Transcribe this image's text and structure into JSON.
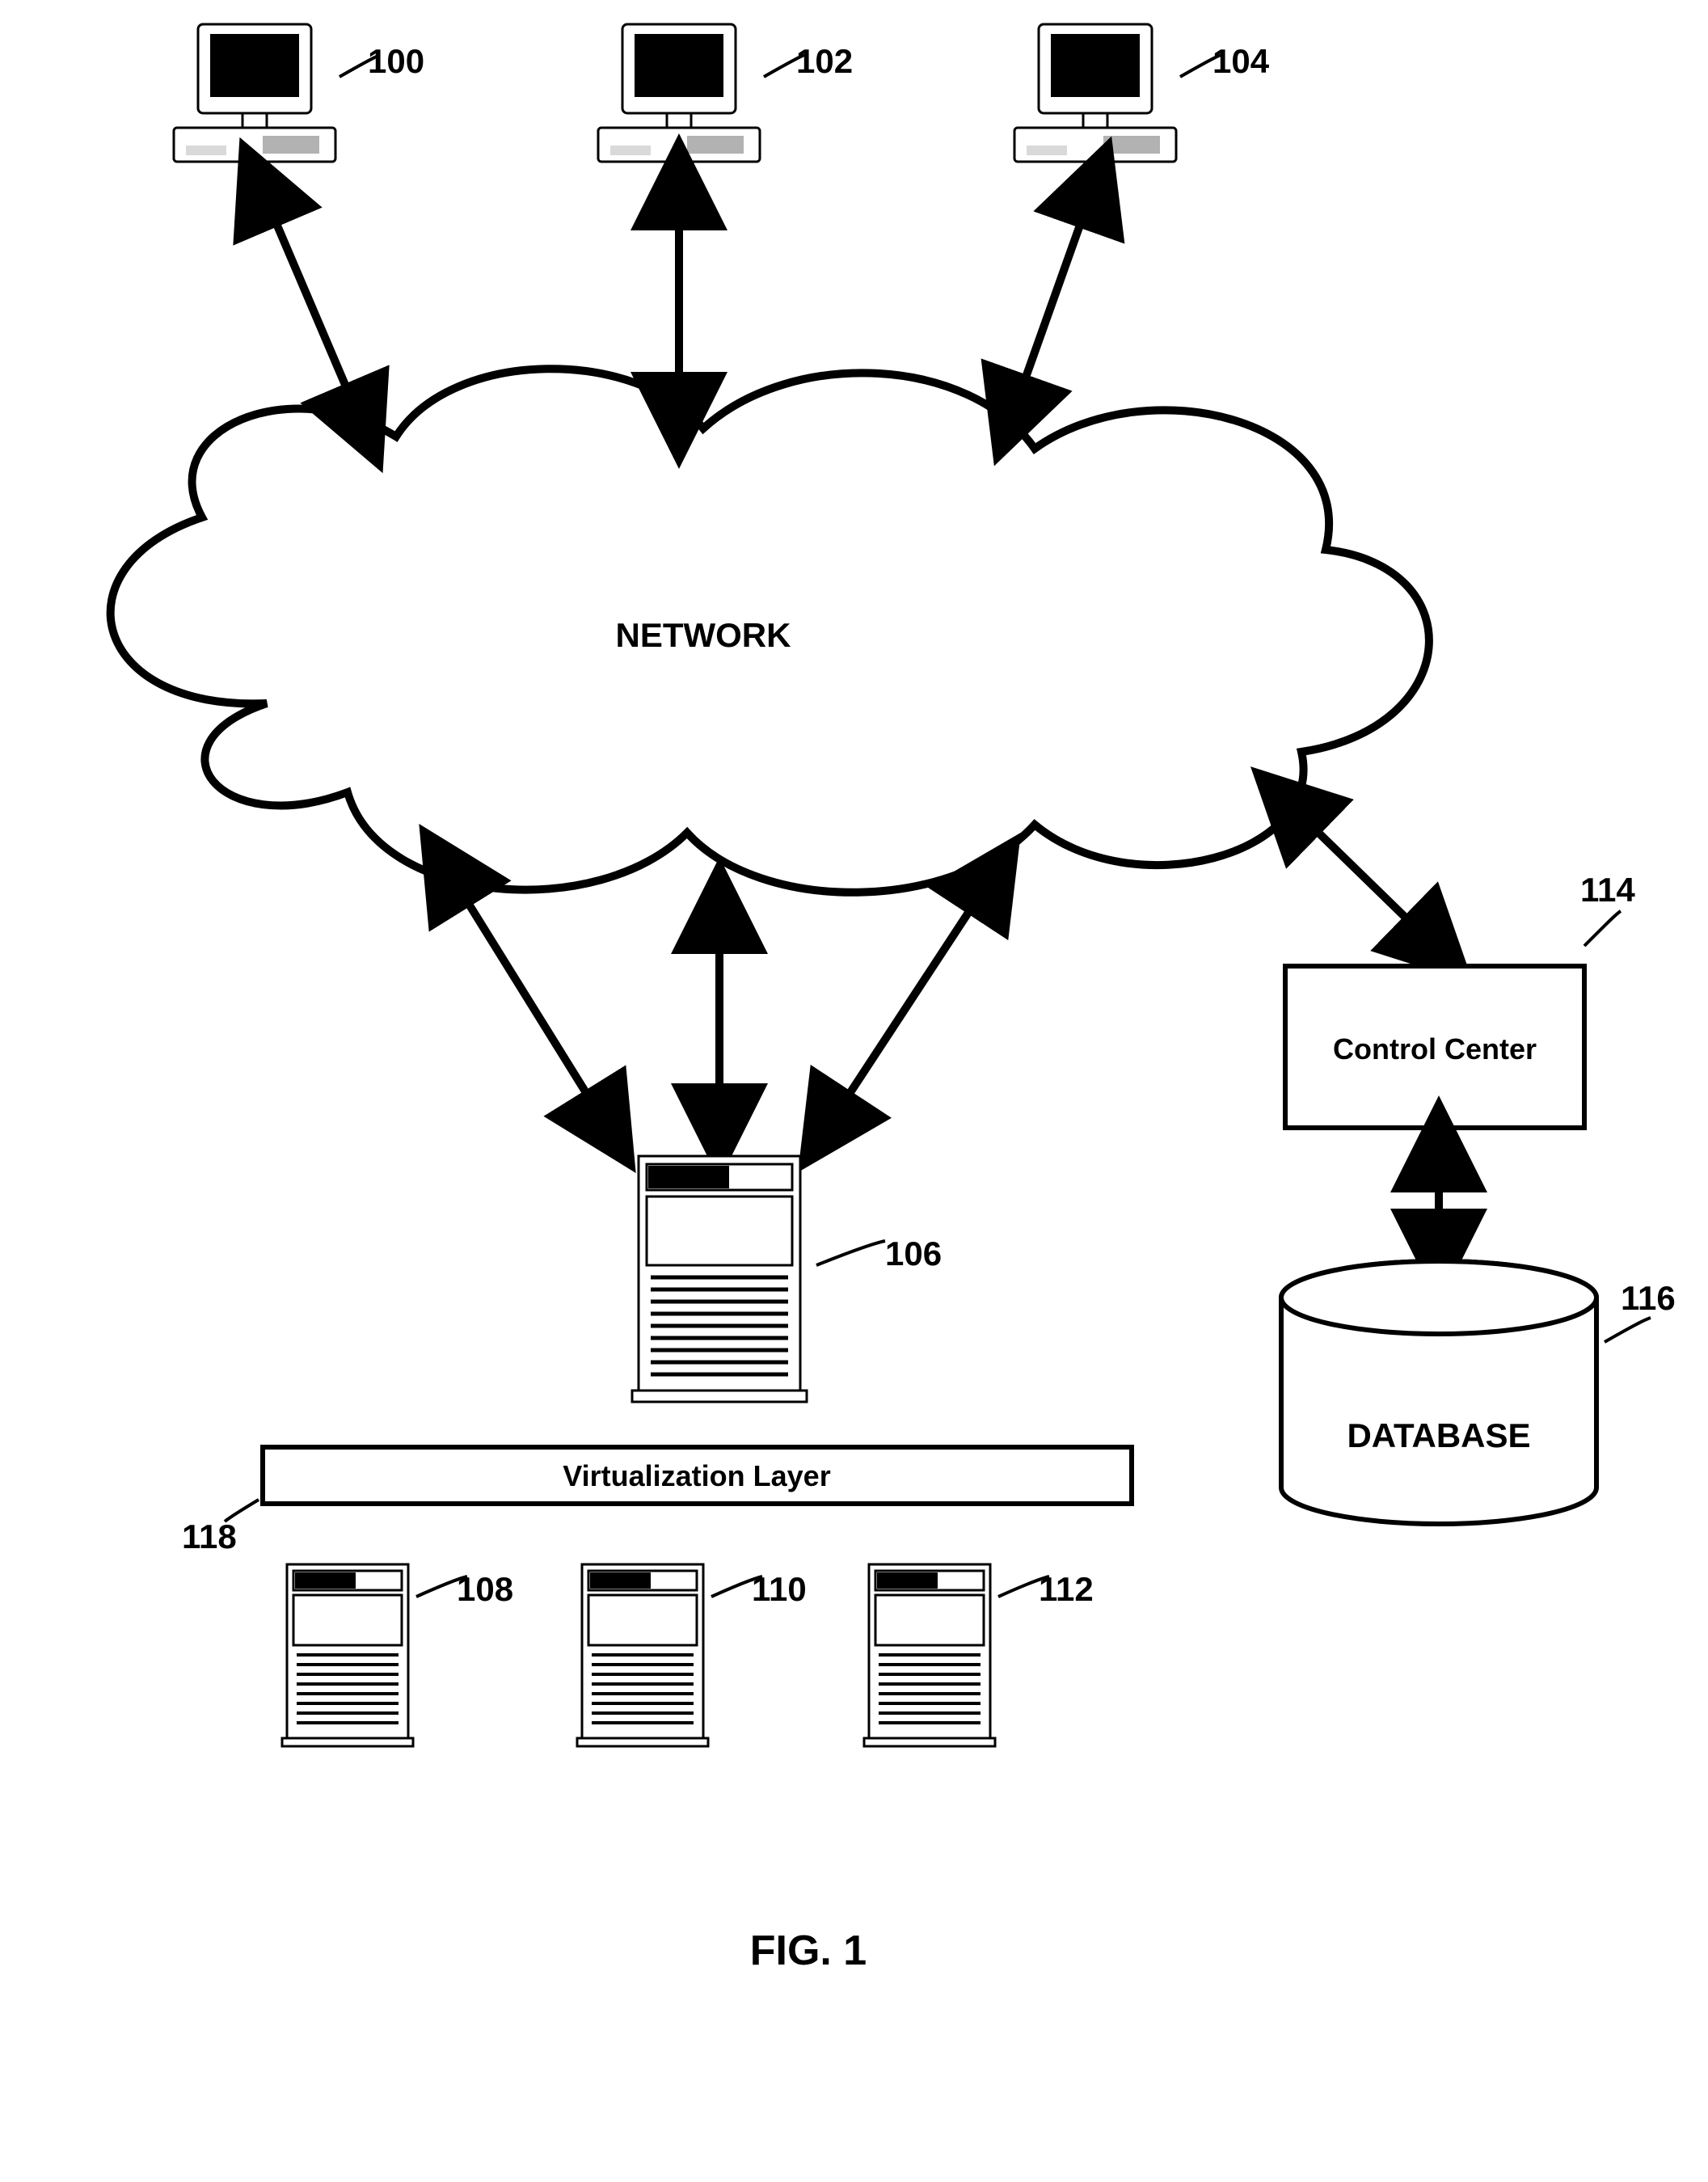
{
  "figure_caption": "FIG. 1",
  "cloud_label": "NETWORK",
  "control_center": "Control Center",
  "database": "DATABASE",
  "virtualization": "Virtualization Layer",
  "refs": {
    "pc1": "100",
    "pc2": "102",
    "pc3": "104",
    "server_main": "106",
    "server_a": "108",
    "server_b": "110",
    "server_c": "112",
    "control_center": "114",
    "database": "116",
    "virtualization": "118"
  }
}
